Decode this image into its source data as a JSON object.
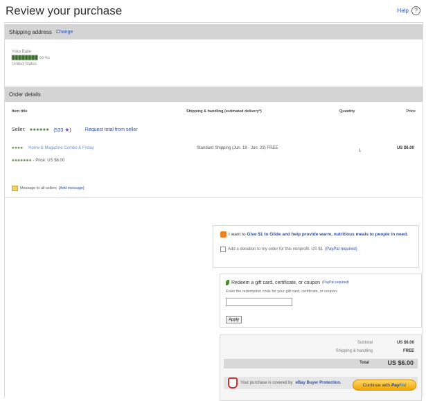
{
  "page": {
    "title": "Review your purchase",
    "help_label": "Help",
    "help_glyph": "?"
  },
  "shipping": {
    "heading": "Shipping address",
    "change_link": "Change",
    "name": "Yoko Balle",
    "line1_redacted": "████████",
    "line1_tail": "oo-ku",
    "country": "United States"
  },
  "order": {
    "heading": "Order details",
    "columns": {
      "title": "Item title",
      "shipping": "Shipping & handling (estimated delivery*)",
      "quantity": "Quantity",
      "price": "Price"
    },
    "seller": {
      "label": "Seller:",
      "name_redacted": "●●●●●●",
      "feedback": "(533",
      "feedback_close": ")",
      "request_total": "Request total from seller"
    },
    "item": {
      "title_redacted": "●●●●",
      "title": "Home & Magazine Combo & Friday",
      "id_redacted": "●●●●●●●",
      "price_line": "- Price: US $6.00",
      "shipping": "Standard Shipping (Jun. 18 - Jun. 23) FREE",
      "quantity": "1",
      "price": "US $6.00"
    },
    "message": {
      "label": "Message to all sellers",
      "link": "[Add message]"
    }
  },
  "charity": {
    "text": "I want to",
    "text_bold": "Give $1 to Glide and help provide warm, nutritious meals to people in need.",
    "checkbox_label": "Add a donation to my order for this nonprofit. US $1",
    "checkbox_link": "(PayPal required)"
  },
  "coupon": {
    "heading": "Redeem a gift card, certificate, or coupon",
    "required": "(PayPal required)",
    "description": "Enter the redemption code for your gift card, certificate, or coupon.",
    "input_value": "",
    "apply_label": "Apply"
  },
  "totals": {
    "subtotal_label": "Subtotal",
    "subtotal_value": "US $6.00",
    "shipping_label": "Shipping & handling",
    "shipping_value": "FREE",
    "total_label": "Total",
    "total_value": "US $6.00",
    "protection_text": "Your purchase is covered by",
    "protection_link": "eBay Buyer Protection."
  },
  "continue": {
    "label": "Continue with",
    "brand_pay": "Pay",
    "brand_pal": "Pal"
  }
}
